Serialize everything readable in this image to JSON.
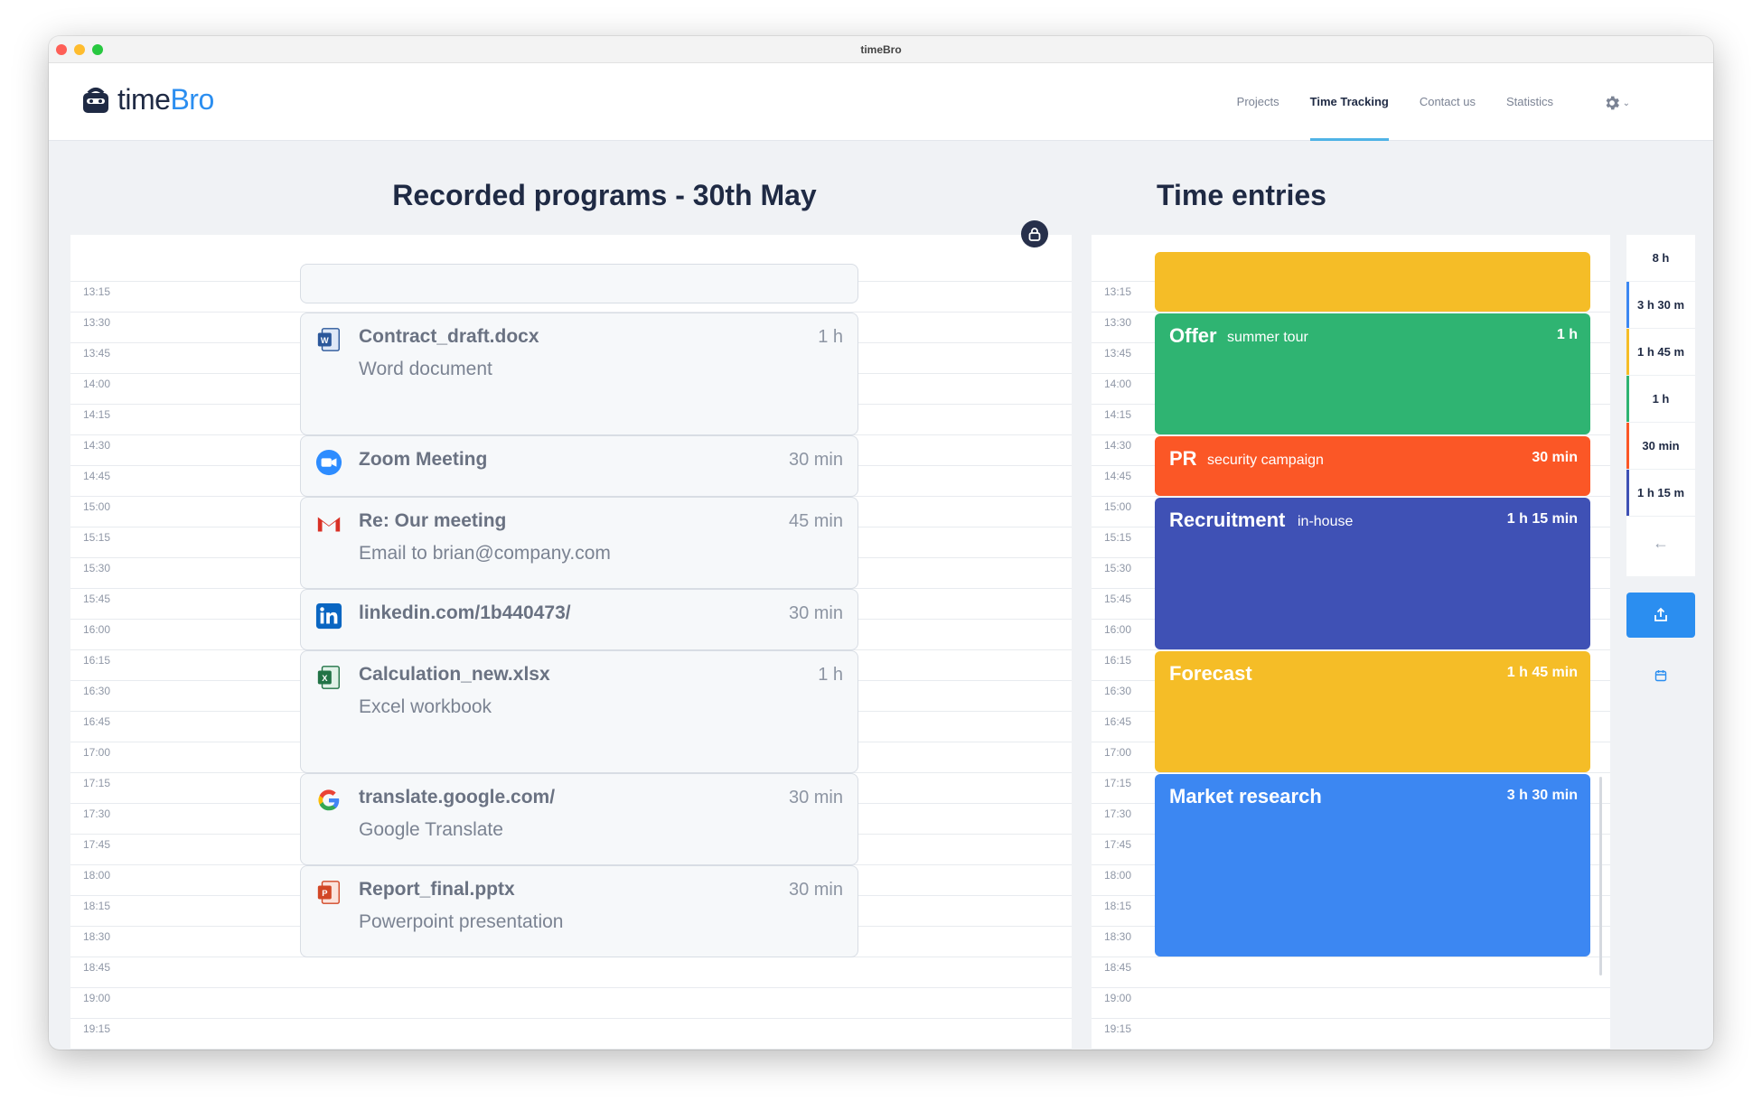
{
  "window": {
    "title": "timeBro"
  },
  "logo": {
    "text_main": "time",
    "text_accent": "Bro"
  },
  "nav": {
    "links": [
      "Projects",
      "Time Tracking",
      "Contact us",
      "Statistics"
    ],
    "active": "Time Tracking"
  },
  "left": {
    "title": "Recorded programs - 30th May"
  },
  "right": {
    "title": "Time entries"
  },
  "times": [
    "13:15",
    "13:30",
    "13:45",
    "14:00",
    "14:15",
    "14:30",
    "14:45",
    "15:00",
    "15:15",
    "15:30",
    "15:45",
    "16:00",
    "16:15",
    "16:30",
    "16:45",
    "17:00",
    "17:15",
    "17:30",
    "17:45",
    "18:00",
    "18:15",
    "18:30",
    "18:45",
    "19:00",
    "19:15"
  ],
  "programs": [
    {
      "icon": "word-icon",
      "title": "Contract_draft.docx",
      "subtitle": "Word document",
      "duration": "1 h"
    },
    {
      "icon": "zoom-icon",
      "title": "Zoom Meeting",
      "subtitle": "",
      "duration": "30 min"
    },
    {
      "icon": "gmail-icon",
      "title": "Re: Our meeting",
      "subtitle": "Email to brian@company.com",
      "duration": "45 min"
    },
    {
      "icon": "linkedin-icon",
      "title": "linkedin.com/1b440473/",
      "subtitle": "",
      "duration": "30 min"
    },
    {
      "icon": "excel-icon",
      "title": "Calculation_new.xlsx",
      "subtitle": "Excel workbook",
      "duration": "1 h"
    },
    {
      "icon": "google-icon",
      "title": "translate.google.com/",
      "subtitle": "Google Translate",
      "duration": "30 min"
    },
    {
      "icon": "powerpoint-icon",
      "title": "Report_final.pptx",
      "subtitle": "Powerpoint presentation",
      "duration": "30 min"
    }
  ],
  "entries": [
    {
      "name": "",
      "tag": "",
      "duration": "",
      "color": "#f5bd27"
    },
    {
      "name": "Offer",
      "tag": "summer tour",
      "duration": "1 h",
      "color": "#2fb472"
    },
    {
      "name": "PR",
      "tag": "security campaign",
      "duration": "30 min",
      "color": "#fb5726"
    },
    {
      "name": "Recruitment",
      "tag": "in-house",
      "duration": "1 h 15 min",
      "color": "#3f51b5"
    },
    {
      "name": "Forecast",
      "tag": "",
      "duration": "1 h 45 min",
      "color": "#f5bd27"
    },
    {
      "name": "Market research",
      "tag": "",
      "duration": "3 h 30 min",
      "color": "#3c87f2"
    }
  ],
  "summary": {
    "total": "8 h",
    "items": [
      {
        "value": "3 h 30 m",
        "color": "#3c87f2"
      },
      {
        "value": "1 h 45 m",
        "color": "#f5bd27"
      },
      {
        "value": "1 h",
        "color": "#2fb472"
      },
      {
        "value": "30 min",
        "color": "#fb5726"
      },
      {
        "value": "1 h 15 m",
        "color": "#3f51b5"
      }
    ],
    "back_icon": "arrow-left-icon"
  }
}
